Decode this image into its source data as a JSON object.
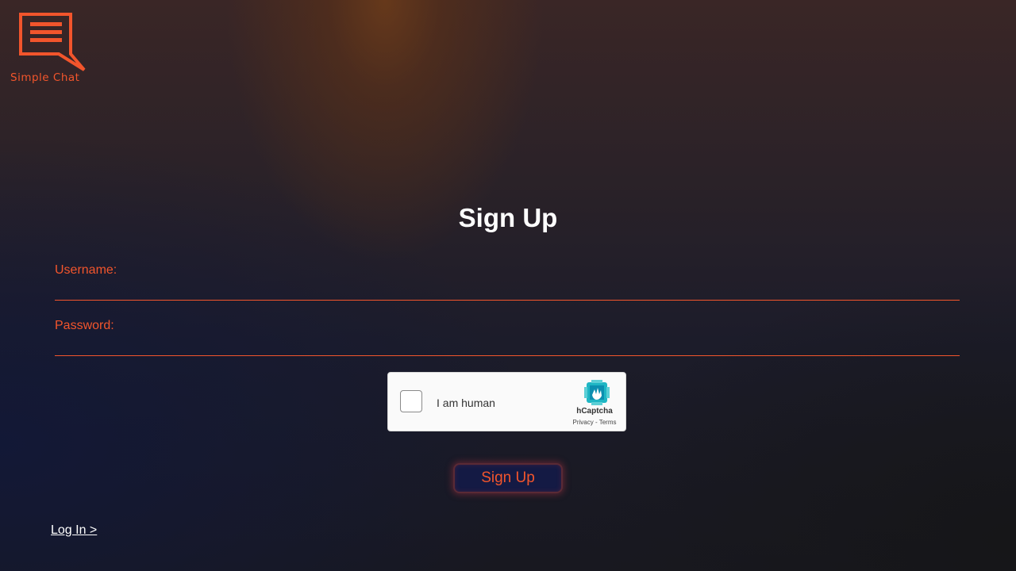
{
  "brand": {
    "name": "Simple Chat",
    "accent_color": "#f2552c",
    "icon": "chat-bubble-icon"
  },
  "title": "Sign Up",
  "form": {
    "username_label": "Username:",
    "username_value": "",
    "password_label": "Password:",
    "password_value": "",
    "submit_label": "Sign Up"
  },
  "captcha": {
    "label": "I am human",
    "brand": "hCaptcha",
    "privacy": "Privacy",
    "separator": " - ",
    "terms": "Terms",
    "checked": false,
    "icon": "hcaptcha-logo-icon"
  },
  "footer": {
    "login_link": "Log In >"
  }
}
